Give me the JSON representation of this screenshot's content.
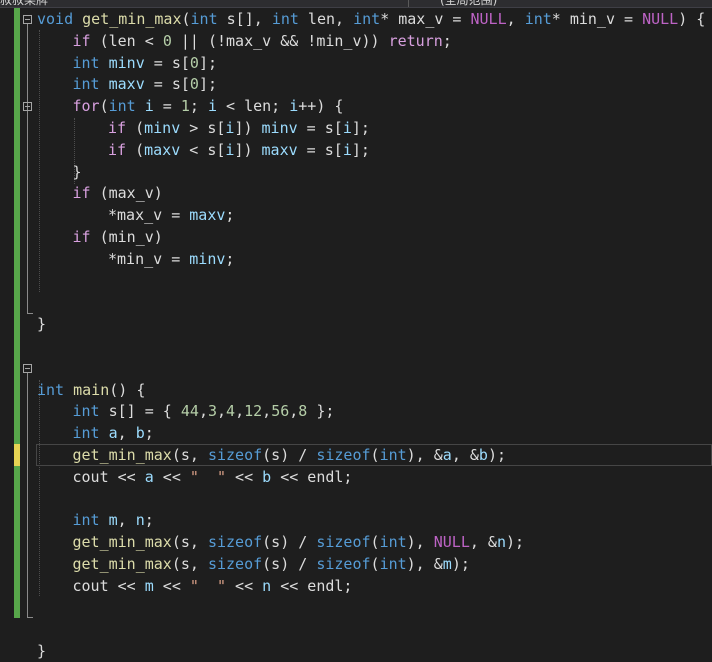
{
  "tabs": {
    "left_fragment": "叔叔某牌",
    "right_fragment": "(全局范围)"
  },
  "lines": [
    {
      "indent": 0,
      "tokens": [
        {
          "t": "void",
          "c": "kw"
        },
        {
          "t": " "
        },
        {
          "t": "get_min_max",
          "c": "fn"
        },
        {
          "t": "("
        },
        {
          "t": "int",
          "c": "kw"
        },
        {
          "t": " s[], "
        },
        {
          "t": "int",
          "c": "kw"
        },
        {
          "t": " len, "
        },
        {
          "t": "int",
          "c": "kw"
        },
        {
          "t": "* max_v = "
        },
        {
          "t": "NULL",
          "c": "mac"
        },
        {
          "t": ", "
        },
        {
          "t": "int",
          "c": "kw"
        },
        {
          "t": "* min_v = "
        },
        {
          "t": "NULL",
          "c": "mac"
        },
        {
          "t": ") {"
        }
      ]
    },
    {
      "indent": 1,
      "tokens": [
        {
          "t": "if",
          "c": "ctl"
        },
        {
          "t": " (len < "
        },
        {
          "t": "0",
          "c": "num"
        },
        {
          "t": " || (!max_v && !min_v)) "
        },
        {
          "t": "return",
          "c": "ctl"
        },
        {
          "t": ";"
        }
      ]
    },
    {
      "indent": 1,
      "tokens": [
        {
          "t": "int",
          "c": "kw"
        },
        {
          "t": " "
        },
        {
          "t": "minv",
          "c": "var"
        },
        {
          "t": " = s["
        },
        {
          "t": "0",
          "c": "num"
        },
        {
          "t": "];"
        }
      ]
    },
    {
      "indent": 1,
      "tokens": [
        {
          "t": "int",
          "c": "kw"
        },
        {
          "t": " "
        },
        {
          "t": "maxv",
          "c": "var"
        },
        {
          "t": " = s["
        },
        {
          "t": "0",
          "c": "num"
        },
        {
          "t": "];"
        }
      ]
    },
    {
      "indent": 1,
      "tokens": [
        {
          "t": "for",
          "c": "ctl"
        },
        {
          "t": "("
        },
        {
          "t": "int",
          "c": "kw"
        },
        {
          "t": " "
        },
        {
          "t": "i",
          "c": "var"
        },
        {
          "t": " = "
        },
        {
          "t": "1",
          "c": "num"
        },
        {
          "t": "; "
        },
        {
          "t": "i",
          "c": "var"
        },
        {
          "t": " < len; "
        },
        {
          "t": "i",
          "c": "var"
        },
        {
          "t": "++) {"
        }
      ]
    },
    {
      "indent": 2,
      "tokens": [
        {
          "t": "if",
          "c": "ctl"
        },
        {
          "t": " ("
        },
        {
          "t": "minv",
          "c": "var"
        },
        {
          "t": " > s["
        },
        {
          "t": "i",
          "c": "var"
        },
        {
          "t": "]) "
        },
        {
          "t": "minv",
          "c": "var"
        },
        {
          "t": " = s["
        },
        {
          "t": "i",
          "c": "var"
        },
        {
          "t": "];"
        }
      ]
    },
    {
      "indent": 2,
      "tokens": [
        {
          "t": "if",
          "c": "ctl"
        },
        {
          "t": " ("
        },
        {
          "t": "maxv",
          "c": "var"
        },
        {
          "t": " < s["
        },
        {
          "t": "i",
          "c": "var"
        },
        {
          "t": "]) "
        },
        {
          "t": "maxv",
          "c": "var"
        },
        {
          "t": " = s["
        },
        {
          "t": "i",
          "c": "var"
        },
        {
          "t": "];"
        }
      ]
    },
    {
      "indent": 1,
      "tokens": [
        {
          "t": "}"
        }
      ]
    },
    {
      "indent": 1,
      "tokens": [
        {
          "t": "if",
          "c": "ctl"
        },
        {
          "t": " (max_v)"
        }
      ]
    },
    {
      "indent": 2,
      "tokens": [
        {
          "t": "*max_v = "
        },
        {
          "t": "maxv",
          "c": "var"
        },
        {
          "t": ";"
        }
      ]
    },
    {
      "indent": 1,
      "tokens": [
        {
          "t": "if",
          "c": "ctl"
        },
        {
          "t": " (min_v)"
        }
      ]
    },
    {
      "indent": 2,
      "tokens": [
        {
          "t": "*min_v = "
        },
        {
          "t": "minv",
          "c": "var"
        },
        {
          "t": ";"
        }
      ]
    },
    {
      "indent": 0,
      "tokens": []
    },
    {
      "indent": 0,
      "tokens": []
    },
    {
      "indent": 0,
      "tokens": [
        {
          "t": "}"
        }
      ]
    },
    {
      "indent": 0,
      "tokens": []
    },
    {
      "indent": 0,
      "tokens": []
    },
    {
      "indent": 0,
      "tokens": [
        {
          "t": "int",
          "c": "kw"
        },
        {
          "t": " "
        },
        {
          "t": "main",
          "c": "fn"
        },
        {
          "t": "() {"
        }
      ]
    },
    {
      "indent": 1,
      "tokens": [
        {
          "t": "int",
          "c": "kw"
        },
        {
          "t": " s[] = { "
        },
        {
          "t": "44",
          "c": "num"
        },
        {
          "t": ","
        },
        {
          "t": "3",
          "c": "num"
        },
        {
          "t": ","
        },
        {
          "t": "4",
          "c": "num"
        },
        {
          "t": ","
        },
        {
          "t": "12",
          "c": "num"
        },
        {
          "t": ","
        },
        {
          "t": "56",
          "c": "num"
        },
        {
          "t": ","
        },
        {
          "t": "8",
          "c": "num"
        },
        {
          "t": " };"
        }
      ]
    },
    {
      "indent": 1,
      "tokens": [
        {
          "t": "int",
          "c": "kw"
        },
        {
          "t": " "
        },
        {
          "t": "a",
          "c": "var"
        },
        {
          "t": ", "
        },
        {
          "t": "b",
          "c": "var"
        },
        {
          "t": ";"
        }
      ]
    },
    {
      "indent": 1,
      "tokens": [
        {
          "t": "get_min_max",
          "c": "fn"
        },
        {
          "t": "(s, "
        },
        {
          "t": "sizeof",
          "c": "kw"
        },
        {
          "t": "(s) / "
        },
        {
          "t": "sizeof",
          "c": "kw"
        },
        {
          "t": "("
        },
        {
          "t": "int",
          "c": "kw"
        },
        {
          "t": "), &"
        },
        {
          "t": "a",
          "c": "var"
        },
        {
          "t": ", &"
        },
        {
          "t": "b",
          "c": "var"
        },
        {
          "t": ");"
        }
      ]
    },
    {
      "indent": 1,
      "tokens": [
        {
          "t": "cout << "
        },
        {
          "t": "a",
          "c": "var"
        },
        {
          "t": " << "
        },
        {
          "t": "\"  \"",
          "c": "str"
        },
        {
          "t": " << "
        },
        {
          "t": "b",
          "c": "var"
        },
        {
          "t": " << endl;"
        }
      ]
    },
    {
      "indent": 0,
      "tokens": []
    },
    {
      "indent": 1,
      "tokens": [
        {
          "t": "int",
          "c": "kw"
        },
        {
          "t": " "
        },
        {
          "t": "m",
          "c": "var"
        },
        {
          "t": ", "
        },
        {
          "t": "n",
          "c": "var"
        },
        {
          "t": ";"
        }
      ]
    },
    {
      "indent": 1,
      "tokens": [
        {
          "t": "get_min_max",
          "c": "fn"
        },
        {
          "t": "(s, "
        },
        {
          "t": "sizeof",
          "c": "kw"
        },
        {
          "t": "(s) / "
        },
        {
          "t": "sizeof",
          "c": "kw"
        },
        {
          "t": "("
        },
        {
          "t": "int",
          "c": "kw"
        },
        {
          "t": "), "
        },
        {
          "t": "NULL",
          "c": "mac"
        },
        {
          "t": ", &"
        },
        {
          "t": "n",
          "c": "var"
        },
        {
          "t": ");"
        }
      ]
    },
    {
      "indent": 1,
      "tokens": [
        {
          "t": "get_min_max",
          "c": "fn"
        },
        {
          "t": "(s, "
        },
        {
          "t": "sizeof",
          "c": "kw"
        },
        {
          "t": "(s) / "
        },
        {
          "t": "sizeof",
          "c": "kw"
        },
        {
          "t": "("
        },
        {
          "t": "int",
          "c": "kw"
        },
        {
          "t": "), &"
        },
        {
          "t": "m",
          "c": "var"
        },
        {
          "t": ");"
        }
      ]
    },
    {
      "indent": 1,
      "tokens": [
        {
          "t": "cout << "
        },
        {
          "t": "m",
          "c": "var"
        },
        {
          "t": " << "
        },
        {
          "t": "\"  \"",
          "c": "str"
        },
        {
          "t": " << "
        },
        {
          "t": "n",
          "c": "var"
        },
        {
          "t": " << endl;"
        }
      ]
    },
    {
      "indent": 0,
      "tokens": []
    },
    {
      "indent": 0,
      "tokens": []
    },
    {
      "indent": 0,
      "tokens": [
        {
          "t": "}"
        }
      ]
    }
  ]
}
